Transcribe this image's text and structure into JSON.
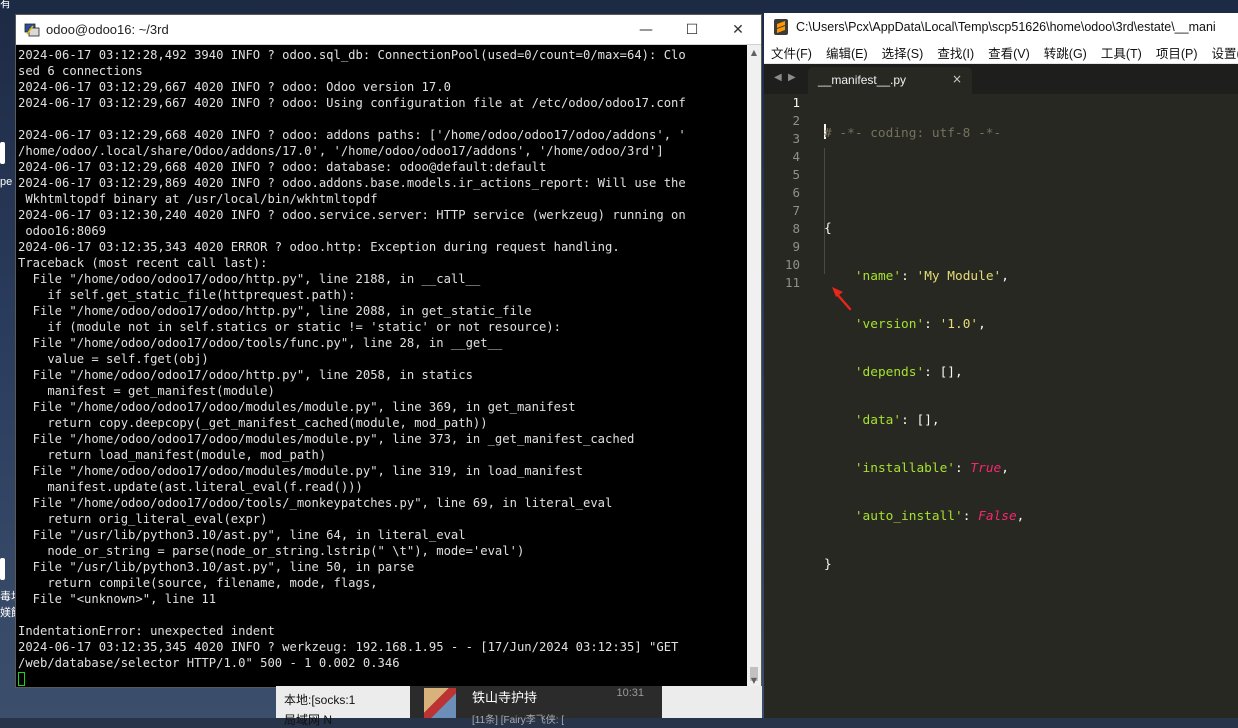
{
  "desktop": {
    "fragments": [
      "有",
      "pe",
      "毒坝",
      "媄饈"
    ]
  },
  "terminal": {
    "title": "odoo@odoo16: ~/3rd",
    "lines": [
      "2024-06-17 03:12:28,492 3940 INFO ? odoo.sql_db: ConnectionPool(used=0/count=0/max=64): Clo",
      "sed 6 connections",
      "2024-06-17 03:12:29,667 4020 INFO ? odoo: Odoo version 17.0",
      "2024-06-17 03:12:29,667 4020 INFO ? odoo: Using configuration file at /etc/odoo/odoo17.conf",
      "",
      "2024-06-17 03:12:29,668 4020 INFO ? odoo: addons paths: ['/home/odoo/odoo17/odoo/addons', '",
      "/home/odoo/.local/share/Odoo/addons/17.0', '/home/odoo/odoo17/addons', '/home/odoo/3rd']",
      "2024-06-17 03:12:29,668 4020 INFO ? odoo: database: odoo@default:default",
      "2024-06-17 03:12:29,869 4020 INFO ? odoo.addons.base.models.ir_actions_report: Will use the",
      " Wkhtmltopdf binary at /usr/local/bin/wkhtmltopdf",
      "2024-06-17 03:12:30,240 4020 INFO ? odoo.service.server: HTTP service (werkzeug) running on",
      " odoo16:8069",
      "2024-06-17 03:12:35,343 4020 ERROR ? odoo.http: Exception during request handling.",
      "Traceback (most recent call last):",
      "  File \"/home/odoo/odoo17/odoo/http.py\", line 2188, in __call__",
      "    if self.get_static_file(httprequest.path):",
      "  File \"/home/odoo/odoo17/odoo/http.py\", line 2088, in get_static_file",
      "    if (module not in self.statics or static != 'static' or not resource):",
      "  File \"/home/odoo/odoo17/odoo/tools/func.py\", line 28, in __get__",
      "    value = self.fget(obj)",
      "  File \"/home/odoo/odoo17/odoo/http.py\", line 2058, in statics",
      "    manifest = get_manifest(module)",
      "  File \"/home/odoo/odoo17/odoo/modules/module.py\", line 369, in get_manifest",
      "    return copy.deepcopy(_get_manifest_cached(module, mod_path))",
      "  File \"/home/odoo/odoo17/odoo/modules/module.py\", line 373, in _get_manifest_cached",
      "    return load_manifest(module, mod_path)",
      "  File \"/home/odoo/odoo17/odoo/modules/module.py\", line 319, in load_manifest",
      "    manifest.update(ast.literal_eval(f.read()))",
      "  File \"/home/odoo/odoo17/odoo/tools/_monkeypatches.py\", line 69, in literal_eval",
      "    return orig_literal_eval(expr)",
      "  File \"/usr/lib/python3.10/ast.py\", line 64, in literal_eval",
      "    node_or_string = parse(node_or_string.lstrip(\" \\t\"), mode='eval')",
      "  File \"/usr/lib/python3.10/ast.py\", line 50, in parse",
      "    return compile(source, filename, mode, flags,",
      "  File \"<unknown>\", line 11",
      "",
      "IndentationError: unexpected indent",
      "2024-06-17 03:12:35,345 4020 INFO ? werkzeug: 192.168.1.95 - - [17/Jun/2024 03:12:35] \"GET",
      "/web/database/selector HTTP/1.0\" 500 - 1 0.002 0.346"
    ],
    "buttons": {
      "minimize": "—",
      "maximize": "☐",
      "close": "✕"
    }
  },
  "taskbar": {
    "item1_line1": "本地:[socks:1",
    "item1_line2": "局域网 N",
    "chat_name": "铁山寺护持",
    "chat_time": "10:31",
    "chat_msg": "[11条] [Fairy李飞侠: ["
  },
  "editor": {
    "title": "C:\\Users\\Pcx\\AppData\\Local\\Temp\\scp51626\\home\\odoo\\3rd\\estate\\__mani",
    "menu": [
      "文件(F)",
      "编辑(E)",
      "选择(S)",
      "查找(I)",
      "查看(V)",
      "转跳(G)",
      "工具(T)",
      "项目(P)",
      "设置(N)"
    ],
    "tab_label": "__manifest__.py",
    "tab_close": "×",
    "nav_left": "◀",
    "nav_right": "▶",
    "line_numbers": [
      "1",
      "2",
      "3",
      "4",
      "5",
      "6",
      "7",
      "8",
      "9",
      "10",
      "11"
    ],
    "code": {
      "l1": "# -*- coding: utf-8 -*-",
      "l3": "{",
      "l4_key": "'name'",
      "l4_val": "'My Module'",
      "l5_key": "'version'",
      "l5_val": "'1.0'",
      "l6_key": "'depends'",
      "l6_val": "[]",
      "l7_key": "'data'",
      "l7_val": "[]",
      "l8_key": "'installable'",
      "l8_val": "True",
      "l9_key": "'auto_install'",
      "l9_val": "False",
      "l10": "}",
      "colon": ": ",
      "comma": ","
    }
  },
  "colors": {
    "editor_bg": "#272822",
    "string": "#e6db74",
    "key_string": "#a6e22e",
    "constant": "#f92672",
    "comment": "#75715e",
    "annotation_arrow": "#e8261a"
  }
}
